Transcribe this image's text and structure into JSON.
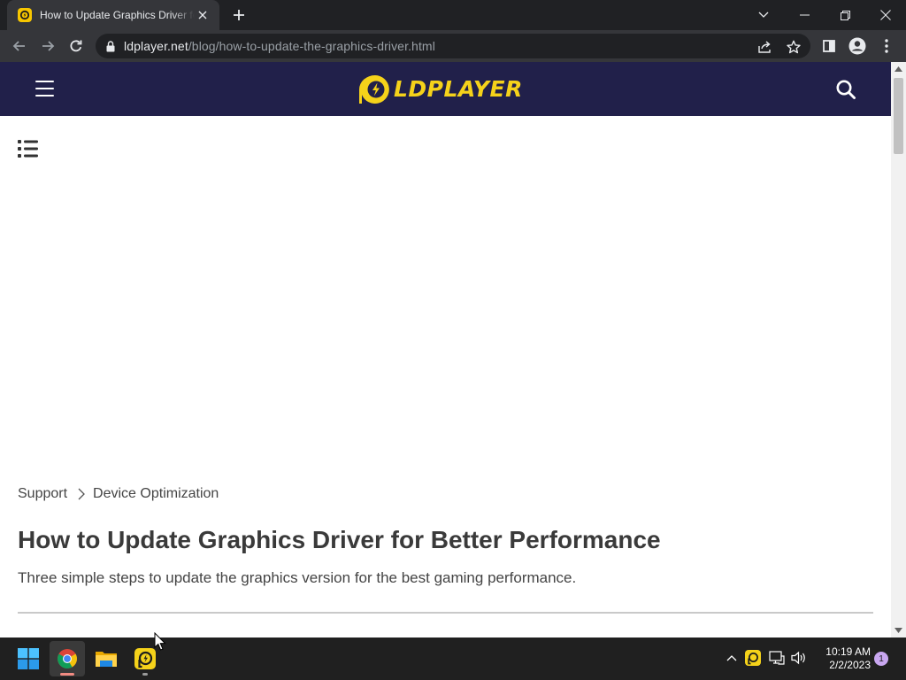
{
  "browser": {
    "tab": {
      "title": "How to Update Graphics Driver for Better Performance"
    },
    "url": {
      "host": "ldplayer.net",
      "path": "/blog/how-to-update-the-graphics-driver.html"
    },
    "icons": {
      "back": "arrow-left-icon",
      "forward": "arrow-right-icon",
      "reload": "reload-icon",
      "lock": "lock-icon",
      "share": "share-icon",
      "bookmark": "star-icon",
      "sidepanel": "side-panel-icon",
      "profile": "profile-icon",
      "menu": "kebab-menu-icon"
    }
  },
  "site": {
    "logo_text": "LDPLAYER",
    "brand_color": "#f5d21a",
    "header_color": "#21204a"
  },
  "article": {
    "breadcrumb": [
      "Support",
      "Device Optimization"
    ],
    "title": "How to Update Graphics Driver for Better Performance",
    "subtitle": "Three simple steps to update the graphics version for the best gaming performance."
  },
  "taskbar": {
    "apps": [
      "windows-start",
      "google-chrome",
      "file-explorer",
      "ldplayer"
    ],
    "clock": {
      "time": "10:19 AM",
      "date": "2/2/2023"
    },
    "notifications": "1"
  }
}
